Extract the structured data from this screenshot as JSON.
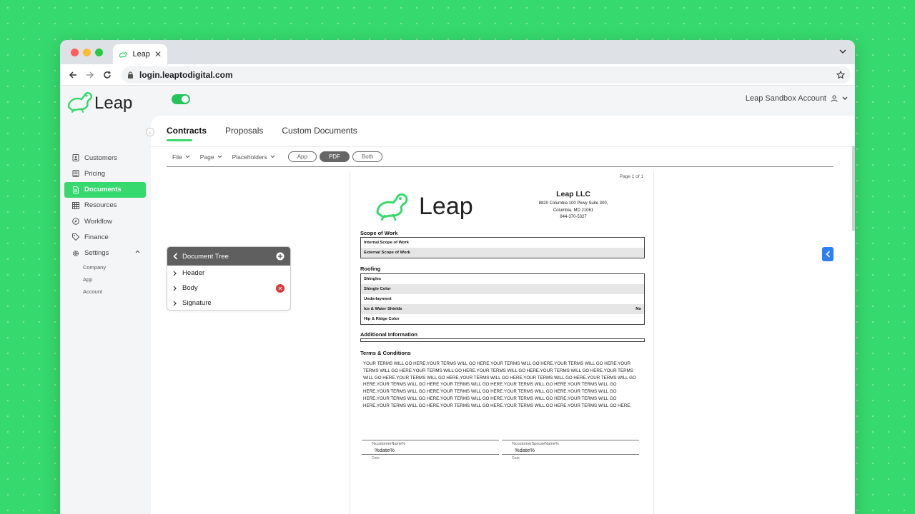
{
  "browser": {
    "tab_title": "Leap",
    "url": "login.leaptodigital.com"
  },
  "header": {
    "logo_text": "Leap",
    "account": "Leap Sandbox Account"
  },
  "sidebar": {
    "items": [
      {
        "label": "Customers",
        "icon": "customers-icon"
      },
      {
        "label": "Pricing",
        "icon": "calculator-icon"
      },
      {
        "label": "Documents",
        "icon": "document-icon"
      },
      {
        "label": "Resources",
        "icon": "grid-icon"
      },
      {
        "label": "Workflow",
        "icon": "compass-icon"
      },
      {
        "label": "Finance",
        "icon": "tag-icon"
      },
      {
        "label": "Settings",
        "icon": "gear-icon"
      }
    ],
    "settings_sub": [
      "Company",
      "App",
      "Account"
    ]
  },
  "tabs": [
    "Contracts",
    "Proposals",
    "Custom Documents"
  ],
  "toolbar": {
    "menus": [
      "File",
      "Page",
      "Placeholders"
    ],
    "modes": [
      "App",
      "PDF",
      "Both"
    ],
    "active_mode": "PDF"
  },
  "doctree": {
    "title": "Document Tree",
    "items": [
      "Header",
      "Body",
      "Signature"
    ]
  },
  "pdf": {
    "page_label": "Page 1 of 1",
    "company_name": "Leap LLC",
    "address1": "8820 Columbia 100 Pkwy Suite 300,",
    "address2": "Columbia, MD 21061",
    "phone": "844-370-5327",
    "scope_title": "Scope of Work",
    "scope_rows": [
      "Internal Scope of Work",
      "External Scope of Work"
    ],
    "roofing_title": "Roofing",
    "roofing_rows": [
      {
        "label": "Shingles",
        "value": ""
      },
      {
        "label": "Shingle Color",
        "value": ""
      },
      {
        "label": "Underlayment",
        "value": ""
      },
      {
        "label": "Ice & Water Shields",
        "value": "No"
      },
      {
        "label": "Hip & Ridge Color",
        "value": ""
      }
    ],
    "additional_title": "Additional Information",
    "terms_title": "Terms & Conditions",
    "terms_text": "YOUR TERMS WILL GO HERE.YOUR TERMS WILL GO HERE.YOUR TERMS WILL GO HERE.YOUR TERMS WILL GO HERE.YOUR TERMS WILL GO HERE.YOUR TERMS WILL GO HERE.YOUR TERMS WILL GO HERE.YOUR TERMS WILL GO HERE.YOUR TERMS WILL GO HERE.YOUR TERMS WILL GO HERE.YOUR TERMS WILL GO HERE.YOUR TERMS WILL GO HERE.YOUR TERMS WILL GO HERE.YOUR TERMS WILL GO HERE.YOUR TERMS WILL GO HERE.YOUR TERMS WILL GO HERE.YOUR TERMS WILL GO HERE.YOUR TERMS WILL GO HERE.YOUR TERMS WILL GO HERE.YOUR TERMS WILL GO HERE.YOUR TERMS WILL GO HERE.YOUR TERMS WILL GO HERE.YOUR TERMS WILL GO HERE.YOUR TERMS WILL GO HERE.YOUR TERMS WILL GO HERE.YOUR TERMS WILL GO HERE.YOUR TERMS WILL GO HERE.YOUR TERMS WILL GO HERE.YOUR TERMS WILL GO HERE.",
    "sig1_name": "%customerName%",
    "sig1_date": "%date%",
    "sig2_name": "%customerSpouseName%",
    "sig2_date": "%date%",
    "date_label": "Date"
  },
  "colors": {
    "brand": "#36d96d",
    "accent_blue": "#2d7ff9",
    "danger": "#d63a3a"
  }
}
